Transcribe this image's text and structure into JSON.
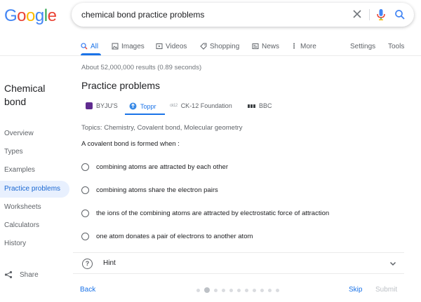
{
  "logo": {
    "letters": [
      {
        "char": "G",
        "color": "#4285F4"
      },
      {
        "char": "o",
        "color": "#EA4335"
      },
      {
        "char": "o",
        "color": "#FBBC05"
      },
      {
        "char": "g",
        "color": "#4285F4"
      },
      {
        "char": "l",
        "color": "#34A853"
      },
      {
        "char": "e",
        "color": "#EA4335"
      }
    ]
  },
  "search": {
    "query": "chemical bond practice problems",
    "icons": {
      "clear": "close-icon",
      "voice": "mic-icon",
      "submit": "search-icon"
    }
  },
  "tabs": {
    "all": "All",
    "images": "Images",
    "videos": "Videos",
    "shopping": "Shopping",
    "news": "News",
    "more": "More",
    "settings": "Settings",
    "tools": "Tools"
  },
  "stats": "About 52,000,000 results (0.89 seconds)",
  "sidebar": {
    "title_line1": "Chemical",
    "title_line2": "bond",
    "items": [
      "Overview",
      "Types",
      "Examples",
      "Practice problems",
      "Worksheets",
      "Calculators",
      "History"
    ],
    "active_item": "Practice problems",
    "share": "Share"
  },
  "practice": {
    "title": "Practice problems",
    "sources": [
      "BYJU'S",
      "Toppr",
      "CK-12 Foundation",
      "BBC"
    ],
    "active_source": "Toppr",
    "topics": "Topics: Chemistry, Covalent bond, Molecular geometry",
    "question": "A covalent bond is formed when :",
    "options": [
      "combining atoms are attracted by each other",
      "combining atoms share the electron pairs",
      "the ions of the combining atoms are attracted by electrostatic force of attraction",
      "one atom donates a pair of electrons to another atom"
    ],
    "hint": "Hint",
    "back": "Back",
    "skip": "Skip",
    "submit": "Submit",
    "pagination": {
      "total": 11,
      "current": 2
    }
  },
  "colors": {
    "accent": "#1a73e8",
    "active_bg": "#e8f0fe"
  }
}
